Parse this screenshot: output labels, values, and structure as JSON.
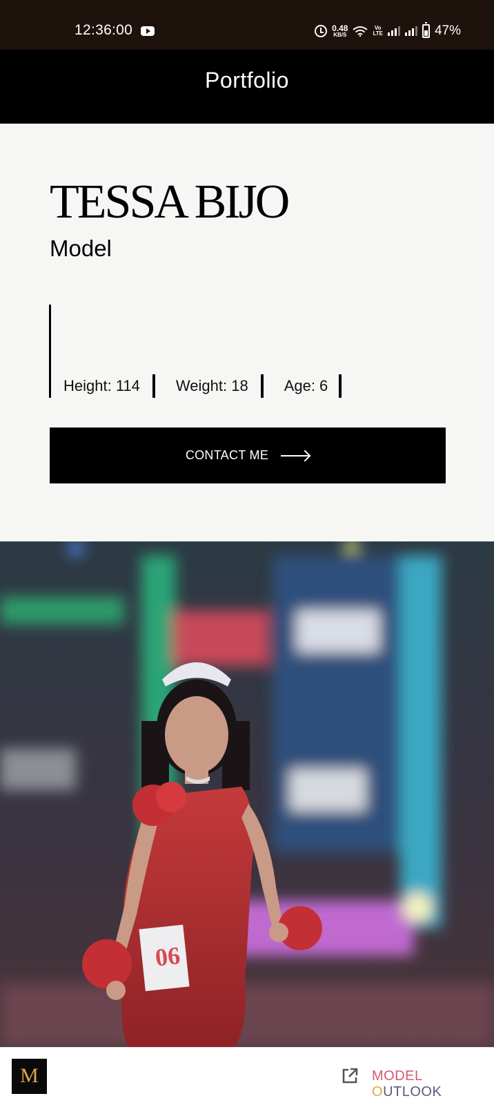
{
  "status_bar": {
    "time": "12:36:00",
    "net_speed_value": "0.48",
    "net_speed_unit": "KB/S",
    "volte_top": "Vo",
    "volte_bottom": "LTE",
    "battery": "47%"
  },
  "header": {
    "title": "Portfolio"
  },
  "profile": {
    "name": "TESSA BIJO",
    "role": "Model",
    "stats": {
      "height": "Height: 114",
      "weight": "Weight: 18",
      "age": "Age: 6"
    }
  },
  "contact_button": {
    "label": "CONTACT ME"
  },
  "photo": {
    "bib_number": "06"
  },
  "bottom_bar": {
    "logo_letter": "M",
    "brand_word_1": "MODEL",
    "brand_word_2_first": "O",
    "brand_word_2_rest": "UTLOOK"
  },
  "icons": {
    "status": [
      "youtube-icon",
      "alarm-icon",
      "wifi-icon",
      "signal-icon",
      "battery-icon"
    ],
    "button": "arrow-right-icon",
    "bottom": "open-external-icon"
  },
  "colors": {
    "status_bar_bg": "#1e120c",
    "header_bg": "#000000",
    "page_bg": "#f6f6f4",
    "button_bg": "#000000",
    "brand_pink": "#d25a6e",
    "brand_gold": "#e0a83c"
  }
}
